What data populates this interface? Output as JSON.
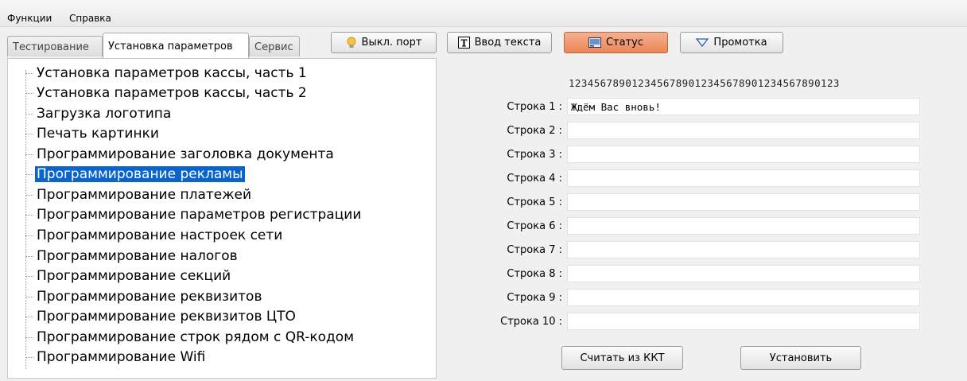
{
  "menu": {
    "items": [
      {
        "label": "Функции"
      },
      {
        "label": "Справка"
      }
    ]
  },
  "tabs": [
    {
      "label": "Тестирование",
      "active": false
    },
    {
      "label": "Установка параметров",
      "active": true
    },
    {
      "label": "Сервис",
      "active": false
    }
  ],
  "toolbar": {
    "port_label": "Выкл. порт",
    "text_input_label": "Ввод текста",
    "status_label": "Статус",
    "feed_label": "Промотка"
  },
  "colors": {
    "selection": "#0a64c9",
    "status_button": "#ec8656"
  },
  "tree": {
    "items": [
      {
        "label": "Установка параметров кассы, часть 1",
        "selected": false
      },
      {
        "label": "Установка параметров кассы, часть 2",
        "selected": false
      },
      {
        "label": "Загрузка логотипа",
        "selected": false
      },
      {
        "label": "Печать картинки",
        "selected": false
      },
      {
        "label": "Программирование заголовка документа",
        "selected": false
      },
      {
        "label": "Программирование рекламы",
        "selected": true
      },
      {
        "label": "Программирование платежей",
        "selected": false
      },
      {
        "label": "Программирование параметров регистрации",
        "selected": false
      },
      {
        "label": "Программирование настроек сети",
        "selected": false
      },
      {
        "label": "Программирование налогов",
        "selected": false
      },
      {
        "label": "Программирование секций",
        "selected": false
      },
      {
        "label": "Программирование реквизитов",
        "selected": false
      },
      {
        "label": "Программирование реквизитов ЦТО",
        "selected": false
      },
      {
        "label": "Программирование строк рядом с QR-кодом",
        "selected": false
      },
      {
        "label": "Программирование Wifi",
        "selected": false
      }
    ]
  },
  "ad_form": {
    "ruler": "1234567890123456789012345678901234567890123",
    "rows": [
      {
        "label": "Строка 1 :",
        "value": "Ждём Вас вновь!"
      },
      {
        "label": "Строка 2 :",
        "value": ""
      },
      {
        "label": "Строка 3 :",
        "value": ""
      },
      {
        "label": "Строка 4 :",
        "value": ""
      },
      {
        "label": "Строка 5 :",
        "value": ""
      },
      {
        "label": "Строка 6 :",
        "value": ""
      },
      {
        "label": "Строка 7 :",
        "value": ""
      },
      {
        "label": "Строка 8 :",
        "value": ""
      },
      {
        "label": "Строка 9 :",
        "value": ""
      },
      {
        "label": "Строка 10 :",
        "value": ""
      }
    ],
    "read_label": "Считать из ККТ",
    "set_label": "Установить"
  }
}
